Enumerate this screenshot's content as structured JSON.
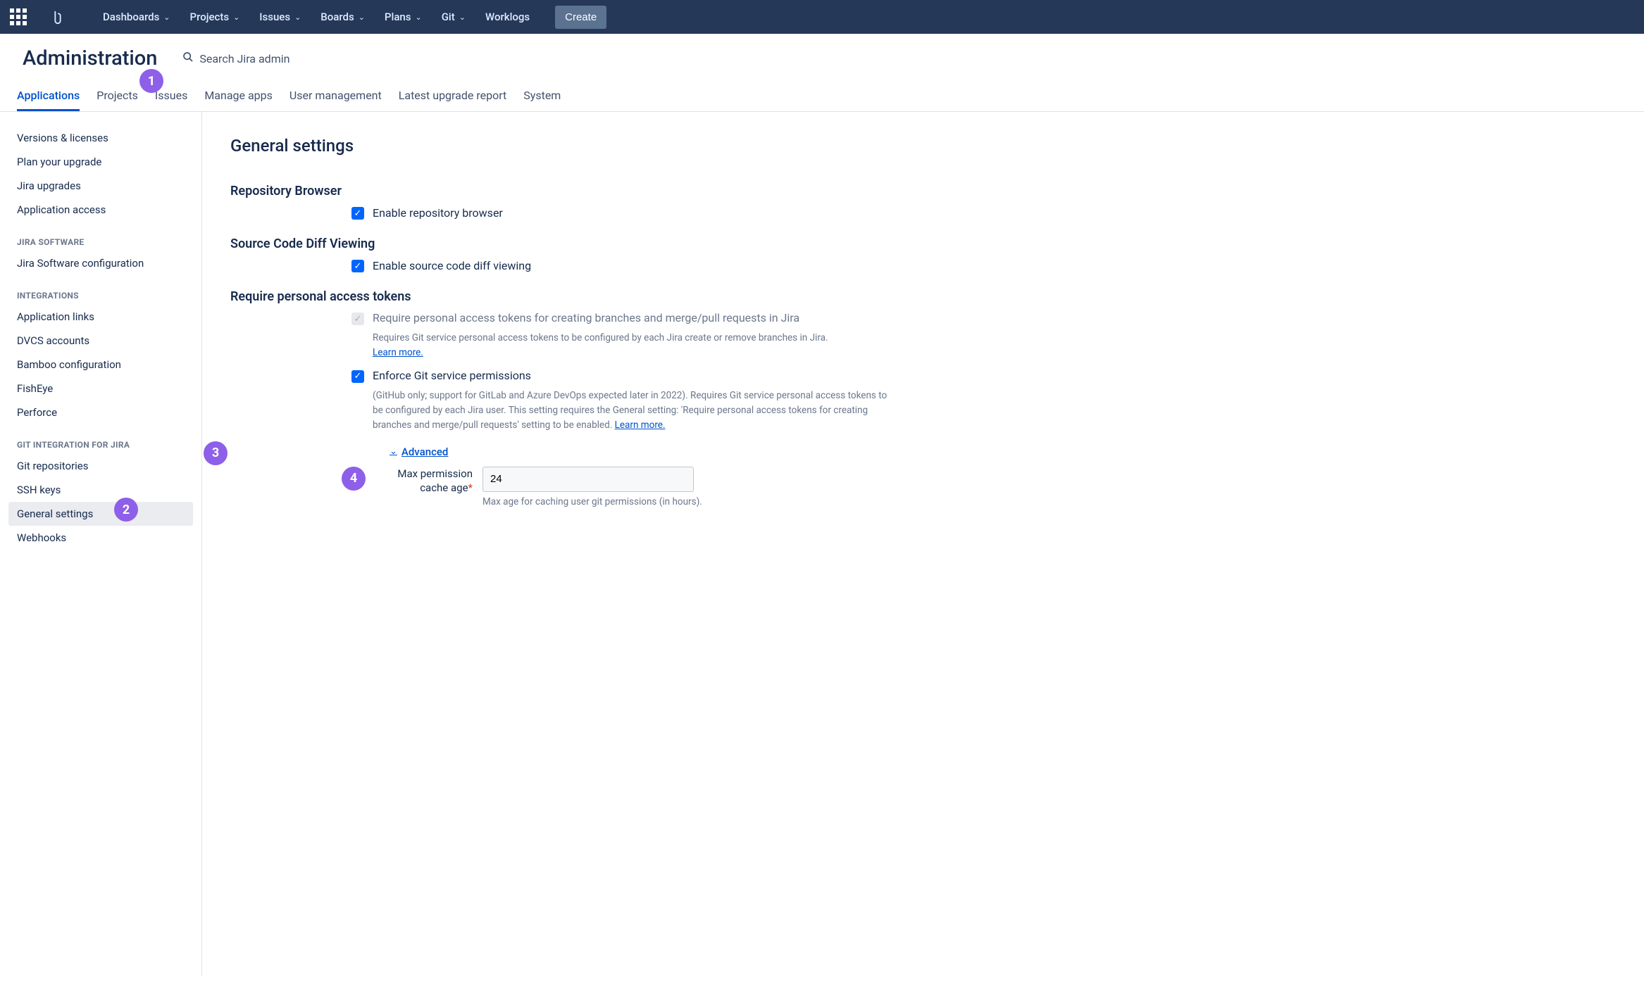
{
  "nav": {
    "items": [
      "Dashboards",
      "Projects",
      "Issues",
      "Boards",
      "Plans",
      "Git",
      "Worklogs"
    ],
    "has_dropdown": [
      true,
      true,
      true,
      true,
      true,
      true,
      false
    ],
    "create": "Create"
  },
  "header": {
    "title": "Administration",
    "search_placeholder": "Search Jira admin"
  },
  "tabs": [
    "Applications",
    "Projects",
    "Issues",
    "Manage apps",
    "User management",
    "Latest upgrade report",
    "System"
  ],
  "active_tab": 0,
  "sidebar": {
    "top": [
      "Versions & licenses",
      "Plan your upgrade",
      "Jira upgrades",
      "Application access"
    ],
    "groups": [
      {
        "heading": "JIRA SOFTWARE",
        "items": [
          "Jira Software configuration"
        ]
      },
      {
        "heading": "INTEGRATIONS",
        "items": [
          "Application links",
          "DVCS accounts",
          "Bamboo configuration",
          "FishEye",
          "Perforce"
        ]
      },
      {
        "heading": "GIT INTEGRATION FOR JIRA",
        "items": [
          "Git repositories",
          "SSH keys",
          "General settings",
          "Webhooks"
        ]
      }
    ],
    "active": "General settings"
  },
  "page": {
    "title": "General settings",
    "sections": {
      "repo_browser": {
        "heading": "Repository Browser",
        "checkbox_label": "Enable repository browser",
        "checked": true
      },
      "diff": {
        "heading": "Source Code Diff Viewing",
        "checkbox_label": "Enable source code diff viewing",
        "checked": true
      },
      "pat": {
        "heading": "Require personal access tokens",
        "require_label": "Require personal access tokens for creating branches and merge/pull requests in Jira",
        "require_checked": true,
        "require_disabled": true,
        "require_help": "Requires Git service personal access tokens to be configured by each Jira create or remove branches in Jira.",
        "learn_more": "Learn more.",
        "enforce_label": "Enforce Git service permissions",
        "enforce_checked": true,
        "enforce_help": "(GitHub only; support for GitLab and Azure DevOps expected later in 2022). Requires Git service personal access tokens to be configured by each Jira user. This setting requires the General setting: 'Require personal access tokens for creating branches and merge/pull requests' setting to be enabled.",
        "advanced_label": "Advanced",
        "max_perm_label": "Max permission cache age",
        "max_perm_value": "24",
        "max_perm_help": "Max age for caching user git permissions (in hours)."
      }
    }
  },
  "badges": {
    "b1": "1",
    "b2": "2",
    "b3": "3",
    "b4": "4"
  }
}
